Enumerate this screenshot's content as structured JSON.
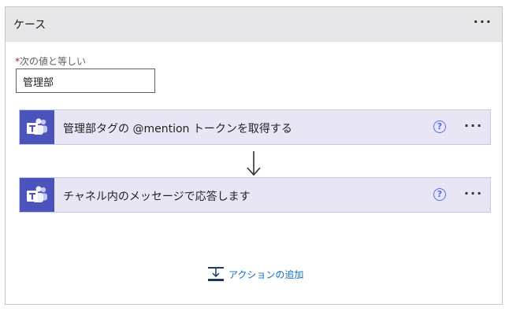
{
  "case": {
    "title": "ケース",
    "menu": "···",
    "field": {
      "required_mark": "*",
      "label": "次の値と等しい",
      "value": "管理部"
    }
  },
  "actions": [
    {
      "title": "管理部タグの @mention トークンを取得する",
      "icon": "teams-icon",
      "help": "?",
      "menu": "···"
    },
    {
      "title": "チャネル内のメッセージで応答します",
      "icon": "teams-icon",
      "help": "?",
      "menu": "···"
    }
  ],
  "add_action": {
    "label": "アクションの追加",
    "icon": "add-action-icon"
  },
  "colors": {
    "teams": "#4b53bc",
    "action_bg": "#e8e6f5",
    "link": "#0f6cbd",
    "header_bg": "#e7e7e9"
  }
}
